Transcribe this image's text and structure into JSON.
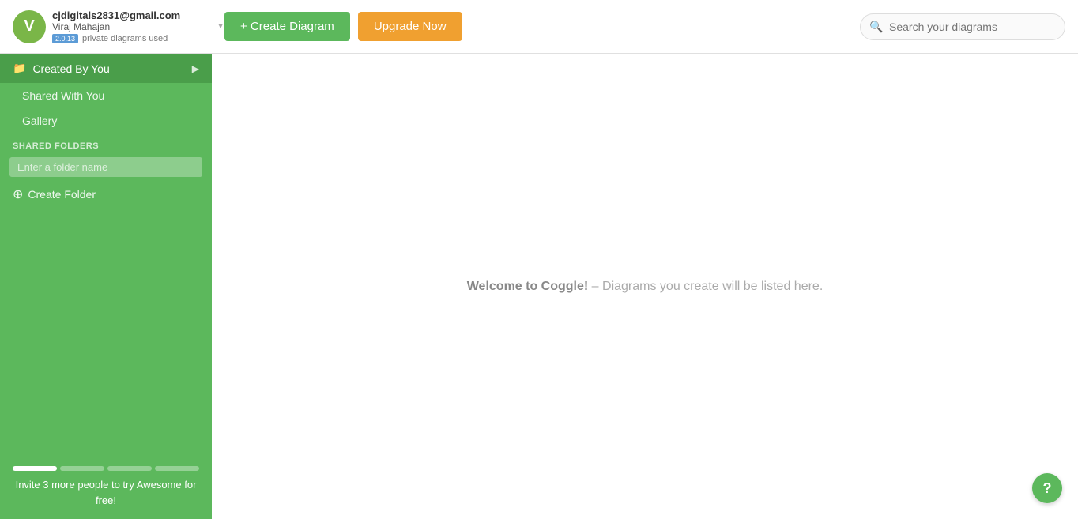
{
  "user": {
    "email": "cjdigitals2831@gmail.com",
    "name": "Viraj Mahajan",
    "plan_badge": "2.0.13",
    "plan_text": "private diagrams used",
    "avatar_letter": "V"
  },
  "topbar": {
    "create_label": "+ Create Diagram",
    "upgrade_label": "Upgrade Now",
    "search_placeholder": "Search your diagrams"
  },
  "sidebar": {
    "nav_items": [
      {
        "label": "Created By You",
        "icon": "📁",
        "active": true
      },
      {
        "label": "Shared With You",
        "active": false
      },
      {
        "label": "Gallery",
        "active": false
      }
    ],
    "shared_folders_label": "SHARED FOLDERS",
    "folder_input_placeholder": "Enter a folder name",
    "create_folder_label": "Create Folder",
    "invite_text": "Invite 3 more people to try Awesome for free!",
    "progress_segments": [
      "filled",
      "empty",
      "empty",
      "empty"
    ]
  },
  "content": {
    "welcome_bold": "Welcome to Coggle!",
    "welcome_rest": " – Diagrams you create will be listed here."
  },
  "help_button_label": "?"
}
